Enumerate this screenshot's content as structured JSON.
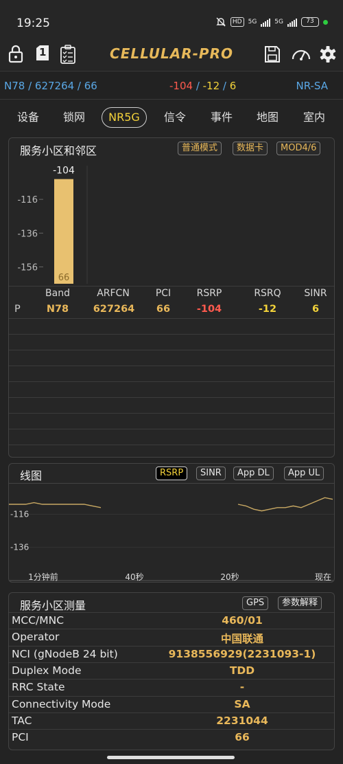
{
  "status_bar": {
    "time": "19:25",
    "hd_badge": "HD",
    "net1": "5G",
    "net2": "5G",
    "battery": "73",
    "dot_color": "#2ecc40"
  },
  "toolbar": {
    "title": "CELLULAR-PRO",
    "sim_number": "1",
    "icons": [
      "lock-icon",
      "sim-card-icon",
      "clipboard-checklist-icon",
      "save-icon",
      "speedometer-icon",
      "gear-icon"
    ]
  },
  "summary": {
    "band_arfcn_pci": "N78 / 627264 / 66",
    "rsrp": "-104",
    "sep1": " / ",
    "rsrq": "-12",
    "sep2": " / ",
    "sinr": "6",
    "mode": "NR-SA"
  },
  "tabs": [
    "设备",
    "锁网",
    "NR5G",
    "信令",
    "事件",
    "地图",
    "室内"
  ],
  "active_tab": "NR5G",
  "serving": {
    "title": "服务小区和邻区",
    "buttons": [
      "普通模式",
      "数据卡",
      "MOD4/6"
    ],
    "chart": {
      "bar_value": -104,
      "bar_label": "-104",
      "bar_pci": "66",
      "ymin": -166,
      "ymax": -96,
      "ticks": [
        "-116",
        "-136",
        "-156"
      ],
      "tick_values": [
        -116,
        -136,
        -156
      ],
      "bar_color": "#e8c170"
    },
    "columns": [
      "Band",
      "ARFCN",
      "PCI",
      "RSRP",
      "RSRQ",
      "SINR"
    ],
    "rows": [
      {
        "type": "P",
        "band": "N78",
        "arfcn": "627264",
        "pci": "66",
        "rsrp": "-104",
        "rsrq": "-12",
        "sinr": "6"
      }
    ]
  },
  "line_chart": {
    "title": "线图",
    "buttons": [
      "RSRP",
      "SINR",
      "App DL",
      "App UL"
    ],
    "active": "RSRP",
    "ticks": [
      "-116",
      "-136"
    ],
    "xlabels": [
      "1分钟前",
      "40秒",
      "20秒",
      "现在"
    ],
    "ymin": -156,
    "ymax": -98,
    "segment1": [
      -110,
      -110,
      -110,
      -109,
      -110,
      -110,
      -110,
      -110,
      -110,
      -110,
      -111,
      -112
    ],
    "segment2": [
      -110,
      -111,
      -113,
      -114,
      -113,
      -112,
      -112,
      -111,
      -112,
      -110,
      -108,
      -106,
      -107
    ]
  },
  "measurement": {
    "title": "服务小区测量",
    "buttons": [
      "GPS",
      "参数解释"
    ],
    "rows": [
      {
        "k": "MCC/MNC",
        "v": "460/01"
      },
      {
        "k": "Operator",
        "v": "中国联通"
      },
      {
        "k": "NCI (gNodeB 24 bit)",
        "v": "9138556929(2231093-1)"
      },
      {
        "k": "Duplex Mode",
        "v": "TDD"
      },
      {
        "k": "RRC State",
        "v": "-"
      },
      {
        "k": "Connectivity Mode",
        "v": "SA"
      },
      {
        "k": "TAC",
        "v": "2231044"
      },
      {
        "k": "PCI",
        "v": "66"
      }
    ]
  }
}
